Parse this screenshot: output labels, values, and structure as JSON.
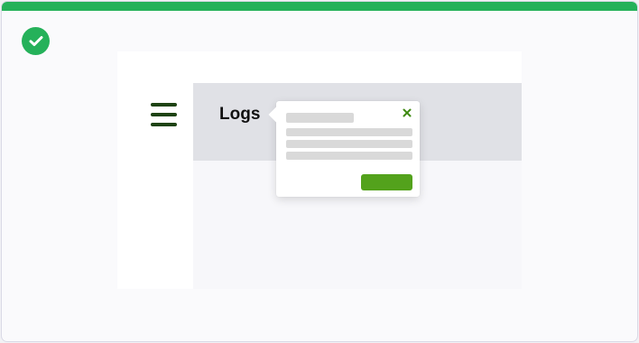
{
  "colors": {
    "accent_green": "#25b15a",
    "menu_icon": "#1e4313",
    "close_icon": "#3f8a12",
    "action_button": "#53a21c",
    "placeholder": "#d9d9d9"
  },
  "status": {
    "icon": "check-circle-icon"
  },
  "sidebar": {
    "menu_icon": "hamburger-menu-icon"
  },
  "header": {
    "title": "Logs"
  },
  "popover": {
    "close_icon": "close-icon",
    "action_label": ""
  }
}
